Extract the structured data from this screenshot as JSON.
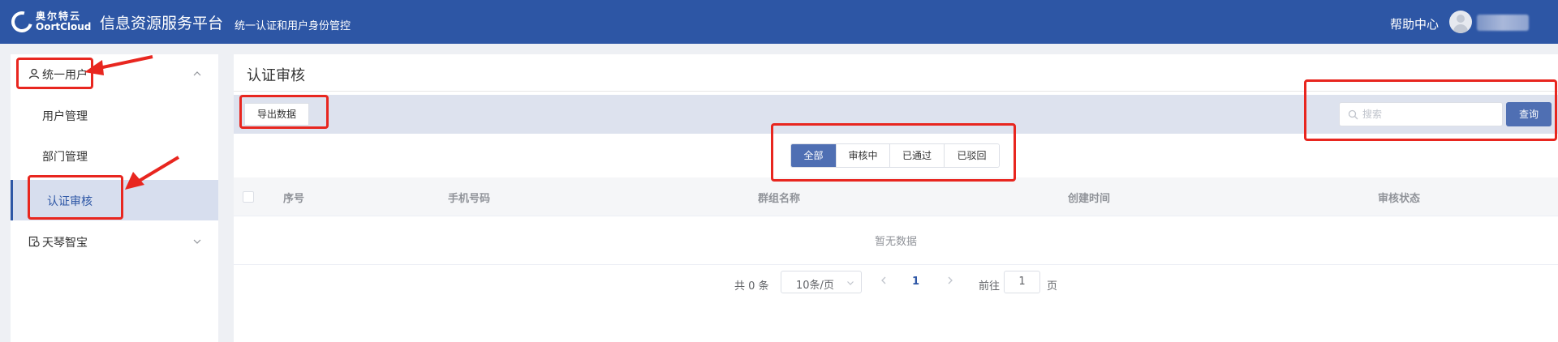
{
  "header": {
    "logo_cn": "奥尔特云",
    "logo_en": "OortCloud",
    "app_title": "信息资源服务平台",
    "app_subtitle": "统一认证和用户身份管控",
    "help_label": "帮助中心"
  },
  "sidebar": {
    "groups": [
      {
        "label": "统一用户",
        "icon": "user-icon",
        "expanded": true,
        "items": [
          {
            "label": "用户管理"
          },
          {
            "label": "部门管理"
          },
          {
            "label": "认证审核",
            "active": true
          }
        ]
      },
      {
        "label": "天琴智宝",
        "icon": "document-icon",
        "expanded": false
      }
    ]
  },
  "main": {
    "page_title": "认证审核",
    "export_label": "导出数据",
    "search_placeholder": "搜索",
    "query_label": "查询",
    "tabs": [
      {
        "label": "全部",
        "active": true
      },
      {
        "label": "审核中"
      },
      {
        "label": "已通过"
      },
      {
        "label": "已驳回"
      }
    ],
    "columns": [
      "序号",
      "手机号码",
      "群组名称",
      "创建时间",
      "审核状态"
    ],
    "empty_text": "暂无数据",
    "pagination": {
      "total": "共 0 条",
      "page_size": "10条/页",
      "current_page": "1",
      "goto_label": "前往",
      "goto_value": "1",
      "page_unit": "页"
    }
  },
  "colors": {
    "header_bg": "#2d56a5",
    "accent": "#4f6fb3",
    "active_menu_bg": "#d7deee",
    "annotation": "#e8261f"
  }
}
